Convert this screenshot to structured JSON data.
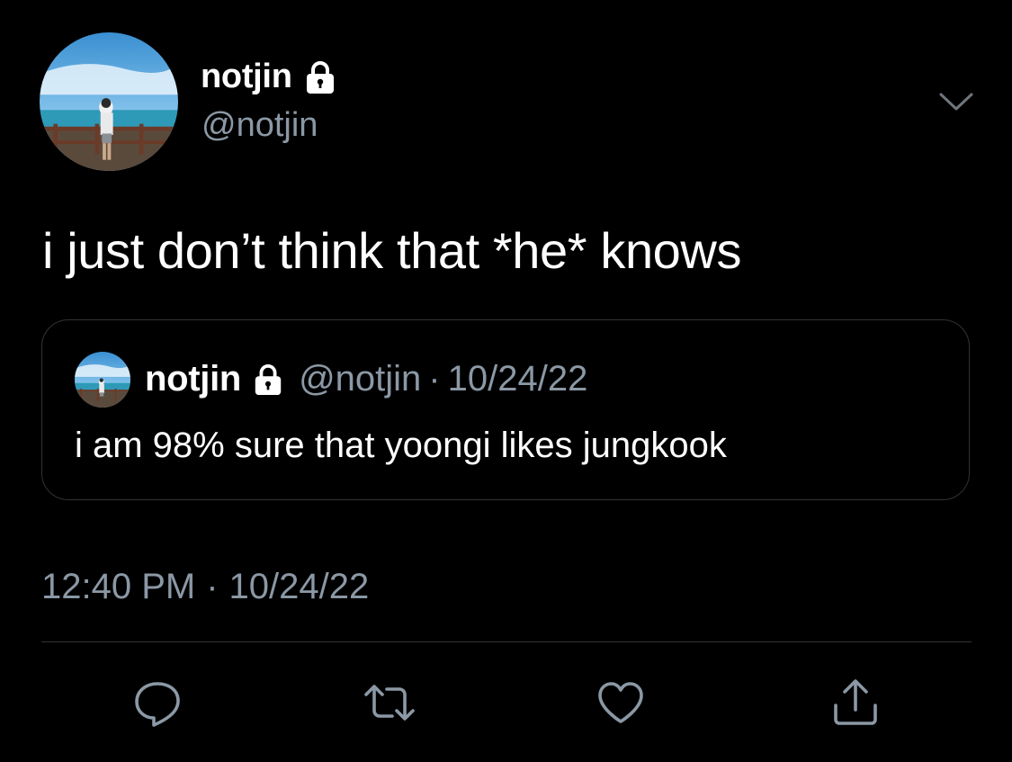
{
  "tweet": {
    "author": {
      "display_name": "notjin",
      "handle": "@notjin",
      "locked_icon": "lock-icon"
    },
    "text": "i just don’t think that *he* knows",
    "timestamp": {
      "time": "12:40 PM",
      "separator": "·",
      "date": "10/24/22"
    },
    "menu_icon": "chevron-down-icon"
  },
  "quoted_tweet": {
    "author": {
      "display_name": "notjin",
      "handle": "@notjin",
      "locked_icon": "lock-icon"
    },
    "separator": "·",
    "date": "10/24/22",
    "text": "i am 98% sure that yoongi likes jungkook"
  },
  "actions": [
    {
      "icon": "reply-icon"
    },
    {
      "icon": "retweet-icon"
    },
    {
      "icon": "like-icon"
    },
    {
      "icon": "share-icon"
    }
  ],
  "colors": {
    "background": "#000000",
    "text_primary": "#ffffff",
    "text_secondary": "#8b98a5",
    "border": "#2f3336"
  }
}
